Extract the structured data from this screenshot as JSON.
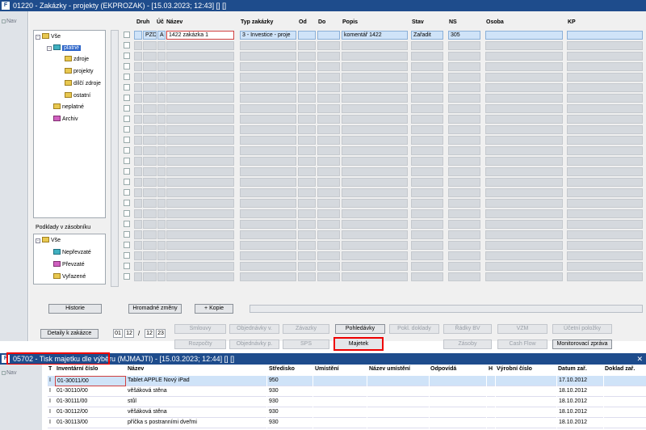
{
  "window1": {
    "title": "01220 - Zakázky - projekty (EKPROZAK) - [15.03.2023; 12:43] [] []",
    "nav_label": "Nav"
  },
  "tree": {
    "items": [
      "Vše",
      "platné",
      "zdroje",
      "projekty",
      "dílčí zdroje",
      "ostatní",
      "neplatné",
      "Archiv"
    ]
  },
  "tree2": {
    "title": "Podklady v zásobníku",
    "items": [
      "Vše",
      "Nepřevzaté",
      "Převzaté",
      "Vyřazené"
    ]
  },
  "grid": {
    "headers": [
      "Druh",
      "Úč",
      "Název",
      "Typ zakázky",
      "Od",
      "Do",
      "Popis",
      "Stav",
      "NS",
      "Osoba",
      "KP"
    ],
    "first_row": {
      "druh": "PZD",
      "uc": "A",
      "nazev": "1422 zakázka 1",
      "typ": "3 - Investice - proje",
      "popis": "komentář 1422",
      "stav": "Zařadit",
      "ns": "305"
    }
  },
  "buttons": {
    "historie": "Historie",
    "hromadne": "Hromadné změny",
    "kopie": "+ Kopie",
    "detaily": "Detaily k zakázce",
    "date1a": "01",
    "date1b": "12",
    "slash": "/",
    "date2a": "12",
    "date2b": "23",
    "smlouvy": "Smlouvy",
    "objednavky_v": "Objednávky v.",
    "zavazky": "Závazky",
    "pohledavky": "Pohledávky",
    "pokl_doklady": "Pokl. doklady",
    "radky_bv": "Řádky BV",
    "vzm": "VZM",
    "ucetni_polozky": "Účetní položky",
    "rozpocty": "Rozpočty",
    "objednavky_p": "Objednávky p.",
    "sps": "SPS",
    "majetek": "Majetek",
    "zasoby": "Zásoby",
    "cash_flow": "Cash Flow",
    "monitorovaci": "Monitorovací zpráva"
  },
  "window2": {
    "title": "05702 - Tisk majetku dle výběru (MJMAJTI) - [15.03.2023; 12:44] [] []",
    "nav_label": "Nav",
    "headers": [
      "T",
      "Inventární číslo",
      "Název",
      "Středisko",
      "Umístění",
      "Název umístění",
      "Odpovídá",
      "H",
      "Výrobní číslo",
      "Datum zař.",
      "Doklad zař."
    ],
    "rows": [
      {
        "t": "I",
        "inv": "01-30011/00",
        "nazev": "Tablet APPLE Nový iPad",
        "stredisko": "950",
        "datum": "17.10.2012"
      },
      {
        "t": "I",
        "inv": "01-30110/00",
        "nazev": "věšáková stěna",
        "stredisko": "930",
        "datum": "18.10.2012"
      },
      {
        "t": "I",
        "inv": "01-30111/00",
        "nazev": "stůl",
        "stredisko": "930",
        "datum": "18.10.2012"
      },
      {
        "t": "I",
        "inv": "01-30112/00",
        "nazev": "věšáková stěna",
        "stredisko": "930",
        "datum": "18.10.2012"
      },
      {
        "t": "I",
        "inv": "01-30113/00",
        "nazev": "příčka s postranními dveřmi",
        "stredisko": "930",
        "datum": "18.10.2012"
      }
    ]
  }
}
